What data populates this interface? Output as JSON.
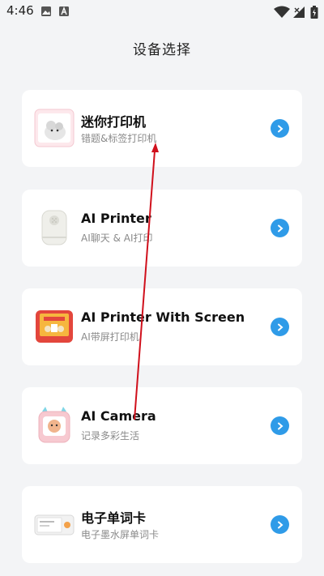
{
  "status_bar": {
    "time": "4:46",
    "icons": [
      "image-icon",
      "a-icon",
      "wifi-icon",
      "signal-icon",
      "battery-icon"
    ]
  },
  "page": {
    "title": "设备选择"
  },
  "devices": [
    {
      "name": "迷你打印机",
      "desc": "错题&标签打印机",
      "thumb_icon": "mini-printer-thumbnail"
    },
    {
      "name": "AI Printer",
      "desc": "AI聊天 & AI打印",
      "thumb_icon": "ai-printer-thumbnail"
    },
    {
      "name": "AI Printer With Screen",
      "desc": "AI带屏打印机",
      "thumb_icon": "ai-printer-screen-thumbnail"
    },
    {
      "name": "AI Camera",
      "desc": "记录多彩生活",
      "thumb_icon": "ai-camera-thumbnail"
    },
    {
      "name": "电子单词卡",
      "desc": "电子墨水屏单词卡",
      "thumb_icon": "word-card-thumbnail"
    }
  ],
  "colors": {
    "accent": "#2f9be8",
    "background": "#f3f4f6",
    "card": "#ffffff",
    "annotation_arrow": "#d0101c"
  }
}
